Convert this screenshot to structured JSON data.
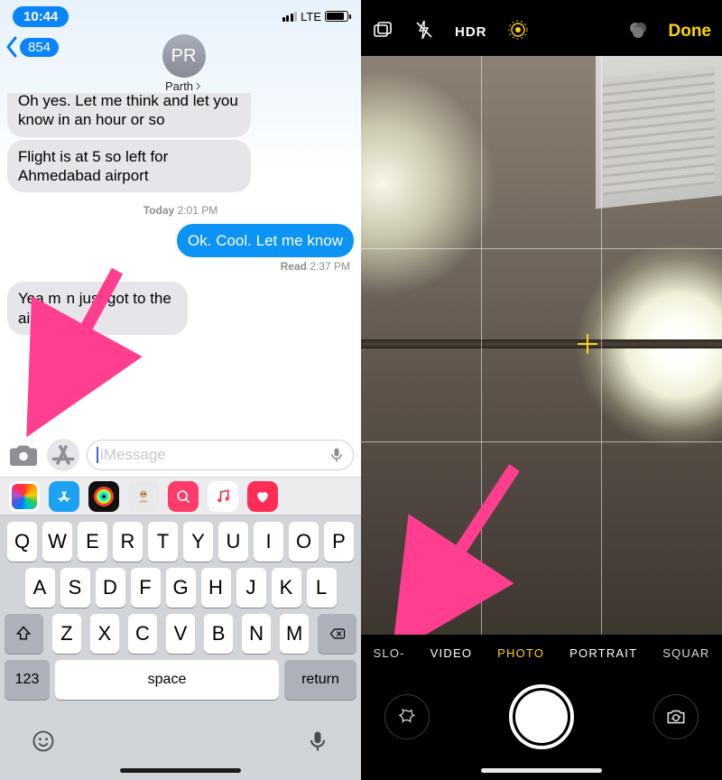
{
  "left": {
    "status": {
      "time": "10:44",
      "carrier": "LTE"
    },
    "nav": {
      "back_count": "854",
      "avatar_initials": "PR",
      "contact_name": "Parth"
    },
    "messages": {
      "m1": "Oh yes. Let me think and let you know in an hour or so",
      "m2": "Flight is at 5 so left for Ahmedabad airport",
      "ts_day": "Today",
      "ts_time": "2:01 PM",
      "m3": "Ok. Cool. Let me know",
      "read_label": "Read",
      "read_time": "2:37 PM",
      "m4_line1": "Yea m",
      "m4_mid": "n just got to the",
      "m4_line2": "air",
      "m4_tail": "t"
    },
    "input": {
      "placeholder": "iMessage"
    },
    "keyboard": {
      "r1": [
        "Q",
        "W",
        "E",
        "R",
        "T",
        "Y",
        "U",
        "I",
        "O",
        "P"
      ],
      "r2": [
        "A",
        "S",
        "D",
        "F",
        "G",
        "H",
        "J",
        "K",
        "L"
      ],
      "r3": [
        "Z",
        "X",
        "C",
        "V",
        "B",
        "N",
        "M"
      ],
      "num": "123",
      "space": "space",
      "ret": "return"
    }
  },
  "right": {
    "top": {
      "hdr": "HDR",
      "done": "Done"
    },
    "modes": {
      "slomo": "SLO-",
      "video": "VIDEO",
      "photo": "PHOTO",
      "portrait": "PORTRAIT",
      "square": "SQUAR"
    }
  }
}
